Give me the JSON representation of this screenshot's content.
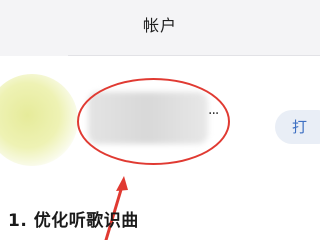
{
  "header": {
    "title": "帐户"
  },
  "account": {
    "ellipsis": "···",
    "action_label": "打"
  },
  "annotation": {
    "color": "#e03a32"
  },
  "step": {
    "text": "1. 优化听歌识曲"
  }
}
